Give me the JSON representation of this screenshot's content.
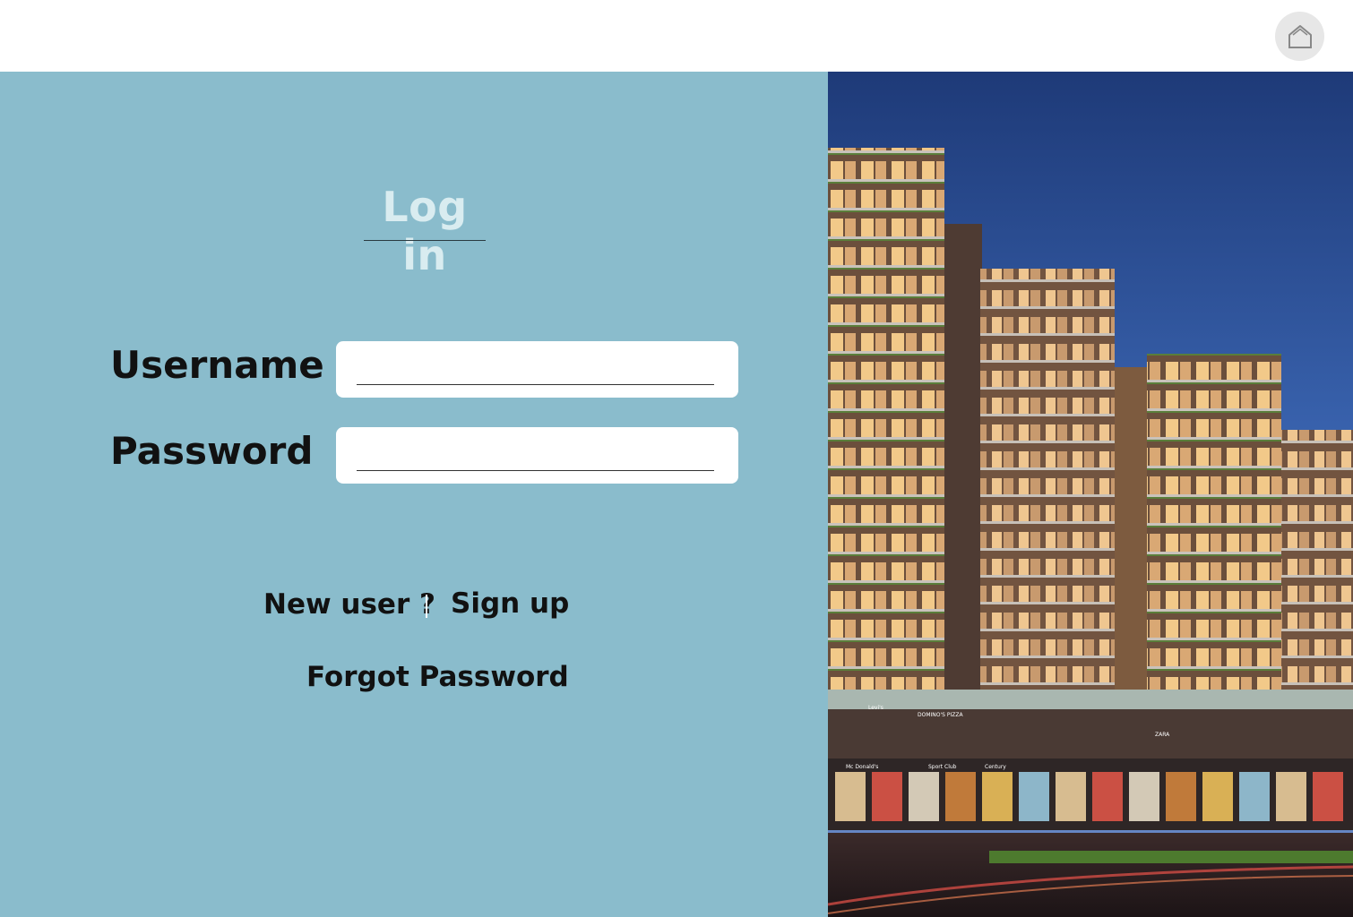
{
  "header": {
    "home_icon": "home-icon"
  },
  "login": {
    "title": "Log in",
    "username_label": "Username :",
    "password_label": "Password  :",
    "username_value": "",
    "password_value": ""
  },
  "links": {
    "new_user": "New user ?",
    "sign_up": "Sign up",
    "forgot_password": "Forgot Password"
  },
  "hero": {
    "image_subject": "night-render-of-residential-towers-with-retail-frontage",
    "shop_signs": [
      "DOMINO'S PIZZA",
      "Mc Donald's",
      "Sport Club",
      "Century",
      "Levi's",
      "ZARA"
    ]
  },
  "colors": {
    "panel_bg": "#8abccc",
    "title_color": "#d9ecf0",
    "sky_top": "#1e3a78",
    "building": "#7a5a44"
  }
}
